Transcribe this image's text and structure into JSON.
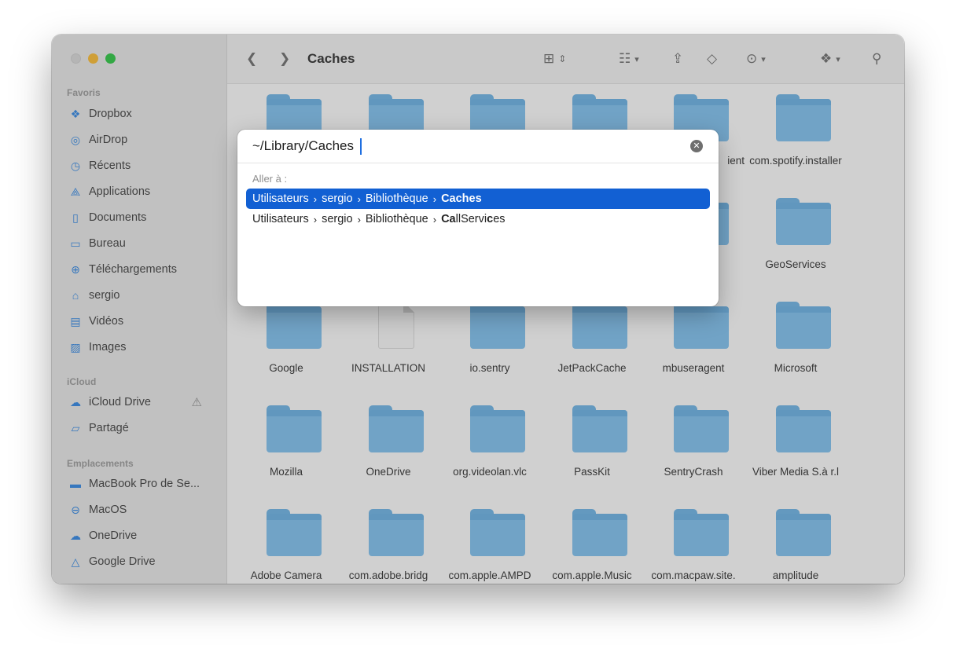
{
  "window": {
    "title": "Caches"
  },
  "sidebar": {
    "favorites_header": "Favoris",
    "favorites": [
      {
        "label": "Dropbox",
        "icon": "dropbox-icon"
      },
      {
        "label": "AirDrop",
        "icon": "airdrop-icon"
      },
      {
        "label": "Récents",
        "icon": "clock-icon"
      },
      {
        "label": "Applications",
        "icon": "applications-icon"
      },
      {
        "label": "Documents",
        "icon": "document-icon"
      },
      {
        "label": "Bureau",
        "icon": "desktop-icon"
      },
      {
        "label": "Téléchargements",
        "icon": "download-icon"
      },
      {
        "label": "sergio",
        "icon": "home-icon"
      },
      {
        "label": "Vidéos",
        "icon": "film-icon"
      },
      {
        "label": "Images",
        "icon": "photo-icon"
      }
    ],
    "icloud_header": "iCloud",
    "icloud": [
      {
        "label": "iCloud Drive",
        "icon": "cloud-icon"
      },
      {
        "label": "Partagé",
        "icon": "shared-folder-icon"
      }
    ],
    "locations_header": "Emplacements",
    "locations": [
      {
        "label": "MacBook Pro de Se...",
        "icon": "laptop-icon"
      },
      {
        "label": "MacOS",
        "icon": "disk-icon"
      },
      {
        "label": "OneDrive",
        "icon": "cloud-icon"
      },
      {
        "label": "Google Drive",
        "icon": "google-drive-icon"
      }
    ]
  },
  "files": [
    {
      "name": ""
    },
    {
      "name": ""
    },
    {
      "name": ""
    },
    {
      "name": ""
    },
    {
      "name": "ient"
    },
    {
      "name": "com.spotify.installer"
    },
    {
      "name": ""
    },
    {
      "name": ""
    },
    {
      "name": ""
    },
    {
      "name": ""
    },
    {
      "name": ""
    },
    {
      "name": "GeoServices"
    },
    {
      "name": "Google"
    },
    {
      "name": "INSTALLATION",
      "kind": "document"
    },
    {
      "name": "io.sentry"
    },
    {
      "name": "JetPackCache"
    },
    {
      "name": "mbuseragent"
    },
    {
      "name": "Microsoft"
    },
    {
      "name": "Mozilla"
    },
    {
      "name": "OneDrive"
    },
    {
      "name": "org.videolan.vlc"
    },
    {
      "name": "PassKit"
    },
    {
      "name": "SentryCrash"
    },
    {
      "name": "Viber Media S.à r.l"
    },
    {
      "name": "Adobe Camera"
    },
    {
      "name": "com.adobe.bridg"
    },
    {
      "name": "com.apple.AMPD"
    },
    {
      "name": "com.apple.Music"
    },
    {
      "name": "com.macpaw.site."
    },
    {
      "name": "amplitude"
    }
  ],
  "goto_dialog": {
    "input_value": "~/Library/Caches",
    "section_label": "Aller à :",
    "suggestions": [
      {
        "parts": [
          "Utilisateurs",
          "sergio",
          "Bibliothèque"
        ],
        "match": "Caches",
        "rest": "",
        "selected": true
      },
      {
        "parts": [
          "Utilisateurs",
          "sergio",
          "Bibliothèque"
        ],
        "match": "Ca",
        "rest": "llServi",
        "match2": "c",
        "rest2": "es",
        "selected": false
      }
    ]
  },
  "colors": {
    "accent": "#1260d3",
    "folder": "#7dc2f2"
  }
}
